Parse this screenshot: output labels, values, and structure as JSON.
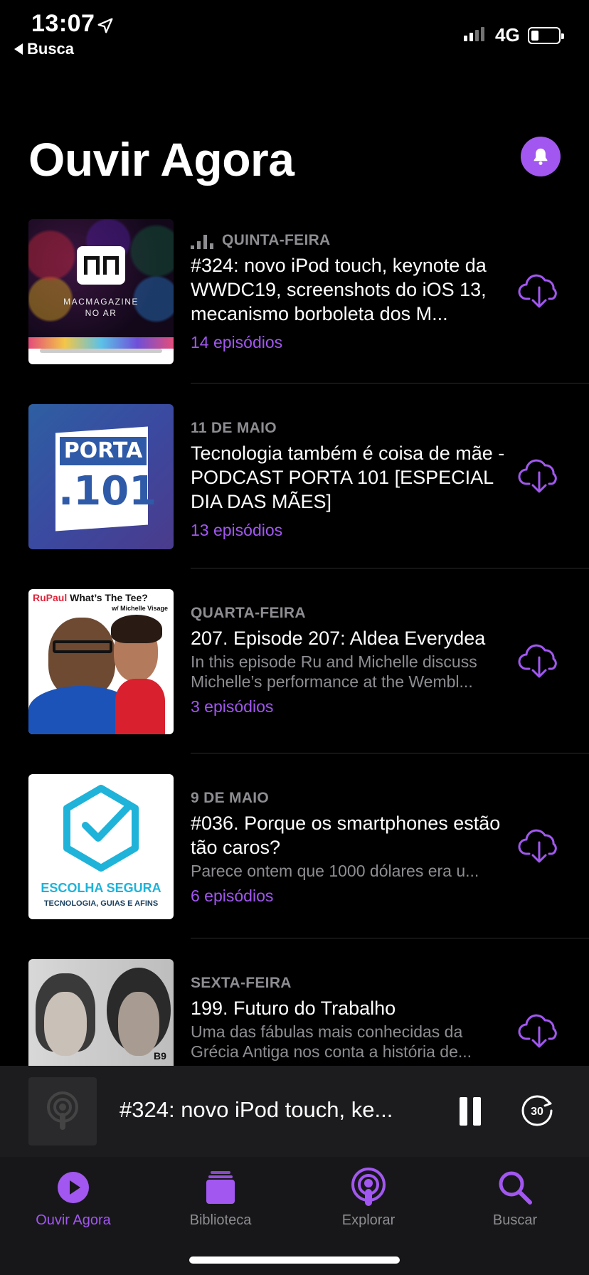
{
  "status_bar": {
    "time": "13:07",
    "back_label": "Busca",
    "network": "4G"
  },
  "header": {
    "title": "Ouvir Agora",
    "notification_icon": "bell-icon"
  },
  "colors": {
    "accent": "#a257f0",
    "secondary_text": "#8d8d92",
    "background": "#000000"
  },
  "episodes": [
    {
      "date": "QUINTA-FEIRA",
      "playing_indicator": true,
      "title": "#324: novo iPod touch, keynote da WWDC19, screenshots do iOS 13, mecanismo borboleta dos M...",
      "description": "",
      "count": "14 episódios",
      "artwork": {
        "lines": [
          "MACMAGAZINE",
          "NO AR"
        ]
      }
    },
    {
      "date": "11 DE MAIO",
      "title": "Tecnologia também é coisa de mãe - PODCAST PORTA 101 [ESPECIAL DIA DAS MÃES]",
      "description": "",
      "count": "13 episódios",
      "artwork": {
        "lines": [
          "PORTA",
          ".101"
        ]
      }
    },
    {
      "date": "QUARTA-FEIRA",
      "title": "207. Episode 207: Aldea Everydea",
      "description": "In this episode Ru and Michelle discuss Michelle’s performance at the Wembl...",
      "count": "3 episódios",
      "artwork": {
        "lines": [
          "RuPaul",
          "What’s The Tee?",
          "w/ Michelle Visage"
        ]
      }
    },
    {
      "date": "9 DE MAIO",
      "title": "#036. Porque os smartphones estão tão caros?",
      "description": "Parece ontem que 1000 dólares era u...",
      "count": "6 episódios",
      "artwork": {
        "lines": [
          "ESCOLHA SEGURA",
          "TECNOLOGIA, GUIAS E AFINS"
        ]
      }
    },
    {
      "date": "SEXTA-FEIRA",
      "title": "199. Futuro do Trabalho",
      "description": "Uma das fábulas mais conhecidas da Grécia Antiga nos conta a história de...",
      "count": "",
      "artwork": {
        "lines": [
          "B9"
        ]
      }
    }
  ],
  "mini_player": {
    "title": "#324: novo iPod touch, ke...",
    "skip_label": "30"
  },
  "tab_bar": [
    {
      "label": "Ouvir Agora",
      "icon": "play-circle-icon",
      "active": true
    },
    {
      "label": "Biblioteca",
      "icon": "library-icon",
      "active": false
    },
    {
      "label": "Explorar",
      "icon": "podcasts-icon",
      "active": false
    },
    {
      "label": "Buscar",
      "icon": "search-icon",
      "active": false
    }
  ]
}
